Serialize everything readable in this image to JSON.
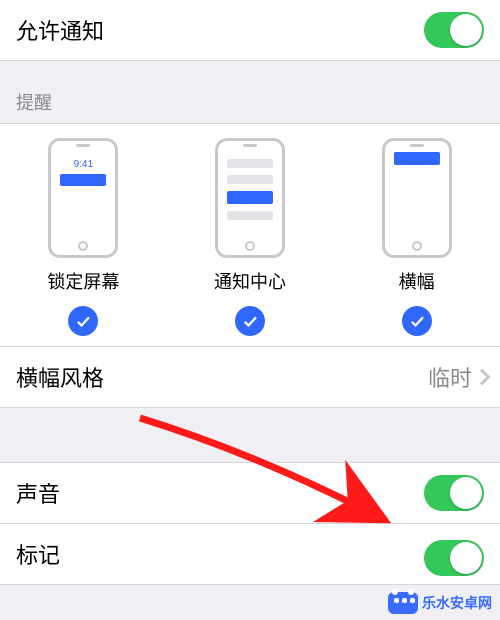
{
  "allow": {
    "label": "允许通知",
    "on": true
  },
  "section_alerts_header": "提醒",
  "alert_options": {
    "lock": {
      "label": "锁定屏幕",
      "checked": true,
      "time": "9:41"
    },
    "center": {
      "label": "通知中心",
      "checked": true
    },
    "banner": {
      "label": "横幅",
      "checked": true
    }
  },
  "banner_style": {
    "label": "横幅风格",
    "value": "临时"
  },
  "sounds": {
    "label": "声音",
    "on": true
  },
  "badges": {
    "label": "标记",
    "on": true
  },
  "watermark": "乐水安卓网",
  "colors": {
    "accent_green": "#34c759",
    "accent_blue": "#2f67ff",
    "arrow": "#ff1a1a"
  }
}
